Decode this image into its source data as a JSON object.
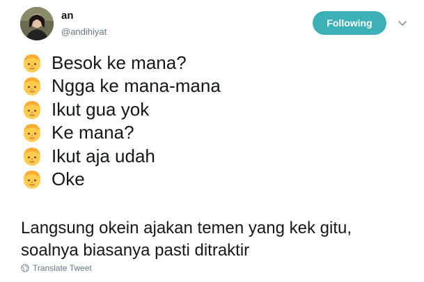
{
  "user": {
    "display_name": "an",
    "handle": "@andihiyat"
  },
  "follow_button": {
    "label": "Following",
    "color": "#3bb0b5"
  },
  "menu": {
    "icon": "chevron-down-icon"
  },
  "conversation": [
    {
      "icon": "person-emoji-icon",
      "text": "Besok ke mana?"
    },
    {
      "icon": "person-emoji-icon",
      "text": "Ngga ke mana-mana"
    },
    {
      "icon": "person-emoji-icon",
      "text": "Ikut gua yok"
    },
    {
      "icon": "person-emoji-icon",
      "text": "Ke mana?"
    },
    {
      "icon": "person-emoji-icon",
      "text": "Ikut aja udah"
    },
    {
      "icon": "person-emoji-icon",
      "text": "Oke"
    }
  ],
  "caption": {
    "line1": "Langsung okein ajakan temen yang kek gitu,",
    "line2": "soalnya biasanya pasti ditraktir"
  },
  "translate": {
    "label": "Translate Tweet",
    "icon": "globe-icon"
  }
}
